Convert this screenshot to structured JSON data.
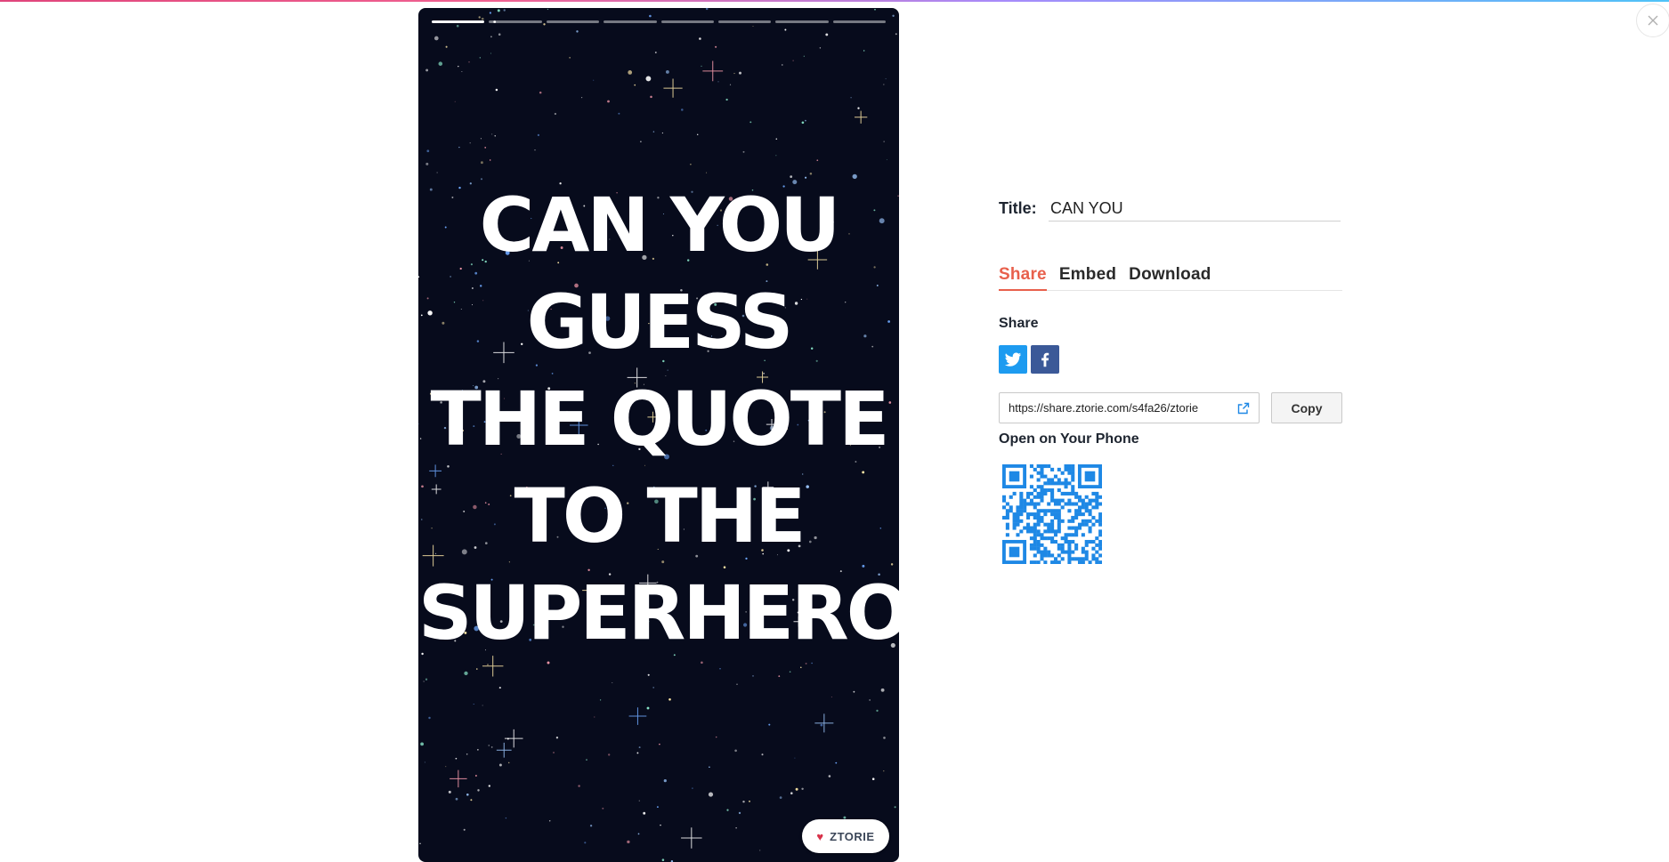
{
  "window": {
    "close_icon": "close-icon"
  },
  "story": {
    "progress_segments": 8,
    "active_segment": 0,
    "title_lines": [
      "CAN YOU",
      "GUESS",
      "THE QUOTE",
      "TO THE",
      "SUPERHERO'"
    ],
    "badge": {
      "icon": "heart-icon",
      "label": "ZTORIE"
    },
    "colors": {
      "background": "#070b1c",
      "text": "#ffffff"
    }
  },
  "panel": {
    "title_label": "Title:",
    "title_value": "CAN YOU",
    "tabs": [
      {
        "label": "Share",
        "active": true
      },
      {
        "label": "Embed",
        "active": false
      },
      {
        "label": "Download",
        "active": false
      }
    ],
    "share_heading": "Share",
    "social": [
      {
        "icon": "twitter-icon",
        "color": "#1d9bf0"
      },
      {
        "icon": "facebook-icon",
        "color": "#3b5998"
      }
    ],
    "share_url": "https://share.ztorie.com/s4fa26/ztorie",
    "copy_label": "Copy",
    "phone_heading": "Open on Your Phone",
    "qr_color": "#1e88e5",
    "accent_color": "#e8604c"
  }
}
